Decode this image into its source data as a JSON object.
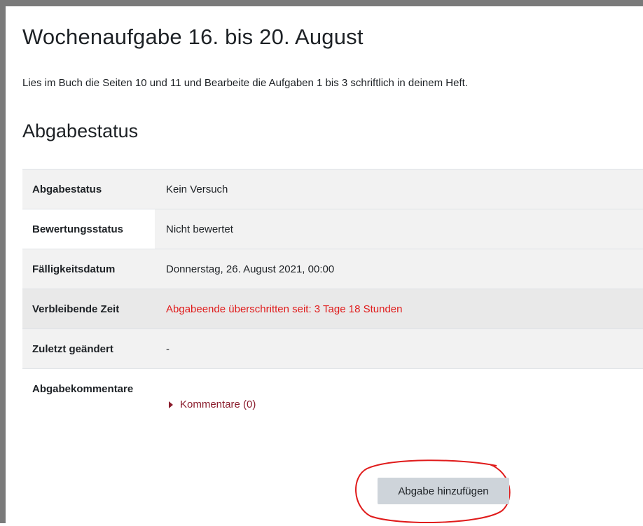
{
  "page": {
    "title": "Wochenaufgabe 16. bis 20. August",
    "intro": "Lies im Buch die Seiten 10 und 11 und Bearbeite die Aufgaben 1 bis 3 schriftlich in deinem Heft."
  },
  "submission": {
    "heading": "Abgabestatus",
    "rows": [
      {
        "label": "Abgabestatus",
        "value": "Kein Versuch"
      },
      {
        "label": "Bewertungsstatus",
        "value": "Nicht bewertet"
      },
      {
        "label": "Fälligkeitsdatum",
        "value": "Donnerstag, 26. August 2021, 00:00"
      },
      {
        "label": "Verbleibende Zeit",
        "value": "Abgabeende überschritten seit: 3 Tage 18 Stunden"
      },
      {
        "label": "Zuletzt geändert",
        "value": "-"
      },
      {
        "label": "Abgabekommentare",
        "value": "Kommentare (0)"
      }
    ]
  },
  "actions": {
    "add_submission_label": "Abgabe hinzufügen"
  },
  "colors": {
    "overdue": "#e01b1b",
    "link": "#8a1c2c",
    "button_bg": "#ced4da",
    "annotation": "#e01b1b"
  }
}
